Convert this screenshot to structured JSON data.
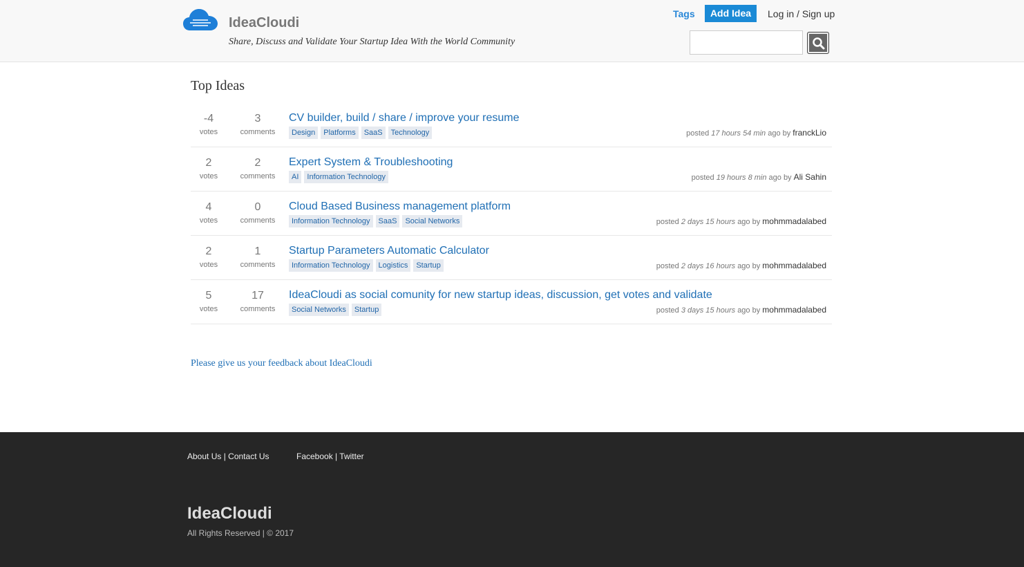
{
  "header": {
    "brand": "IdeaCloudi",
    "tagline": "Share, Discuss and Validate Your Startup Idea With the World Community",
    "nav_tags": "Tags",
    "nav_add": "Add Idea",
    "nav_login": "Log in / Sign up",
    "search_placeholder": ""
  },
  "main": {
    "title": "Top Ideas",
    "votes_label": "votes",
    "comments_label": "comments",
    "posted_label": "posted",
    "ago_label": "ago by",
    "ideas": [
      {
        "votes": "-4",
        "comments": "3",
        "title": "CV builder, build / share / improve your resume",
        "tags": [
          "Design",
          "Platforms",
          "SaaS",
          "Technology"
        ],
        "time": "17 hours 54 min",
        "author": "franckLio"
      },
      {
        "votes": "2",
        "comments": "2",
        "title": "Expert System & Troubleshooting",
        "tags": [
          "AI",
          "Information Technology"
        ],
        "time": "19 hours 8 min",
        "author": "Ali Sahin"
      },
      {
        "votes": "4",
        "comments": "0",
        "title": "Cloud Based Business management platform",
        "tags": [
          "Information Technology",
          "SaaS",
          "Social Networks"
        ],
        "time": "2 days 15 hours",
        "author": "mohmmadalabed"
      },
      {
        "votes": "2",
        "comments": "1",
        "title": "Startup Parameters Automatic Calculator",
        "tags": [
          "Information Technology",
          "Logistics",
          "Startup"
        ],
        "time": "2 days 16 hours",
        "author": "mohmmadalabed"
      },
      {
        "votes": "5",
        "comments": "17",
        "title": "IdeaCloudi as social comunity for new startup ideas, discussion, get votes and validate",
        "tags": [
          "Social Networks",
          "Startup"
        ],
        "time": "3 days 15 hours",
        "author": "mohmmadalabed"
      }
    ],
    "feedback": "Please give us your feedback about IdeaCloudi"
  },
  "footer": {
    "about": "About Us",
    "contact": "Contact Us",
    "facebook": "Facebook",
    "twitter": "Twitter",
    "separator": "|",
    "brand": "IdeaCloudi",
    "rights": "All Rights Reserved | © 2017"
  },
  "colors": {
    "accent": "#1a8ad6",
    "link": "#1f6fb5",
    "footer_bg": "#262626"
  }
}
